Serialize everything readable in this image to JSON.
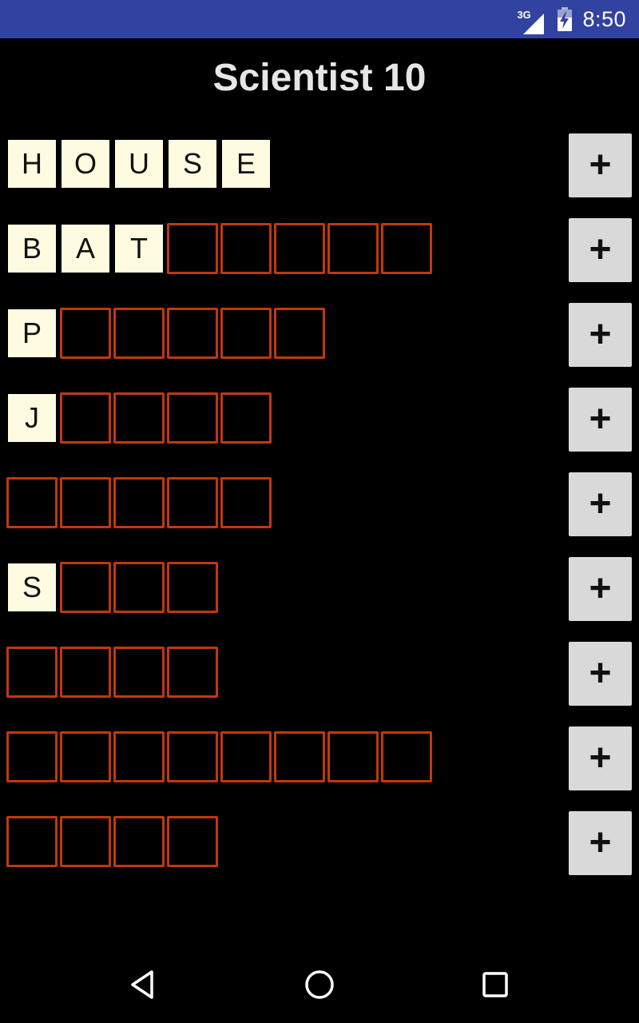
{
  "status_bar": {
    "network": "3G",
    "time": "8:50",
    "icons": [
      "signal-icon",
      "battery-charging-icon"
    ]
  },
  "title": "Scientist 10",
  "rows": [
    {
      "total": 5,
      "letters": [
        "H",
        "O",
        "U",
        "S",
        "E"
      ],
      "button_label": "+"
    },
    {
      "total": 8,
      "letters": [
        "B",
        "A",
        "T"
      ],
      "button_label": "+"
    },
    {
      "total": 6,
      "letters": [
        "P"
      ],
      "button_label": "+"
    },
    {
      "total": 5,
      "letters": [
        "J"
      ],
      "button_label": "+"
    },
    {
      "total": 5,
      "letters": [],
      "button_label": "+"
    },
    {
      "total": 4,
      "letters": [
        "S"
      ],
      "button_label": "+"
    },
    {
      "total": 4,
      "letters": [],
      "button_label": "+"
    },
    {
      "total": 8,
      "letters": [],
      "button_label": "+"
    },
    {
      "total": 4,
      "letters": [],
      "button_label": "+"
    }
  ],
  "nav_bar": {
    "icons": [
      "back-icon",
      "home-icon",
      "recents-icon"
    ]
  },
  "colors": {
    "status_bar": "#3142a1",
    "background": "#000000",
    "tile_filled": "#fffbe0",
    "tile_empty_border": "#c0380f",
    "button": "#d9d9d9"
  }
}
